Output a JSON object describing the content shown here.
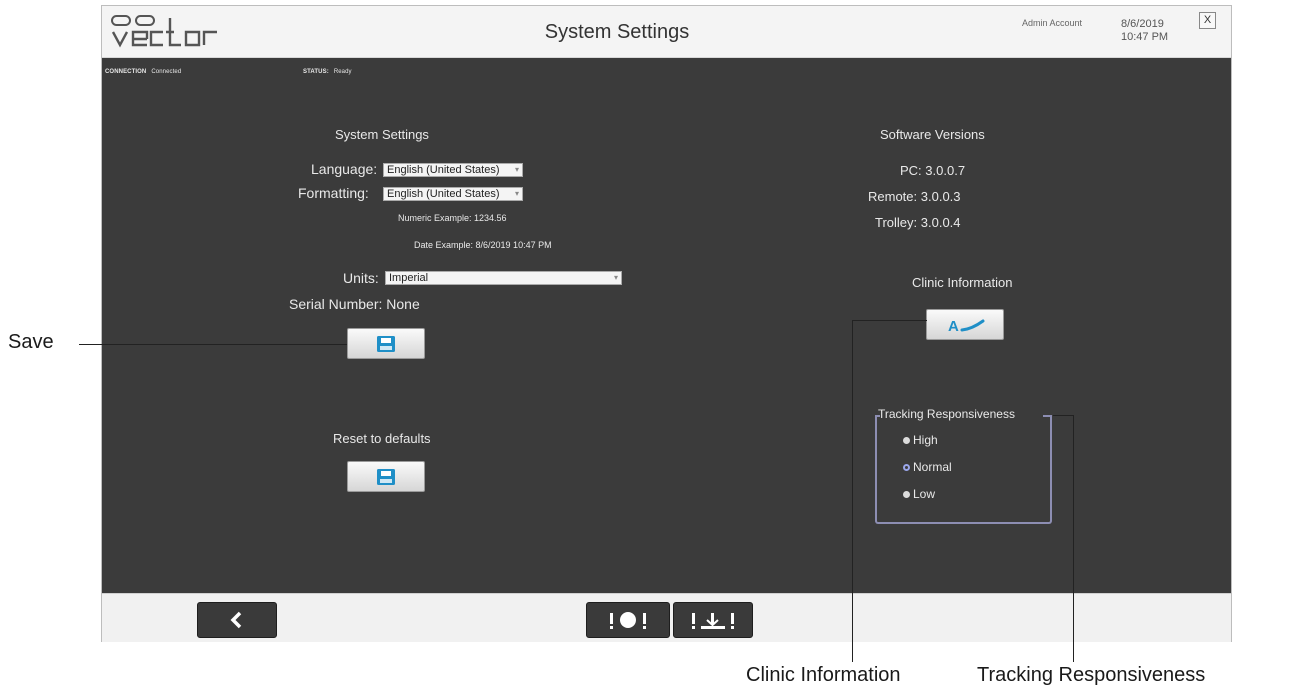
{
  "header": {
    "title": "System Settings",
    "account": "Admin Account",
    "date": "8/6/2019",
    "time": "10:47 PM",
    "close_label": "X"
  },
  "status_bar": {
    "connection_label": "CONNECTION",
    "connection_value": "Connected",
    "status_label": "STATUS:",
    "status_value": "Ready"
  },
  "system_settings": {
    "heading": "System Settings",
    "language_label": "Language:",
    "language_value": "English (United States)",
    "formatting_label": "Formatting:",
    "formatting_value": "English (United States)",
    "numeric_example": "Numeric Example:  1234.56",
    "date_example": "Date Example:  8/6/2019 10:47 PM",
    "units_label": "Units:",
    "units_value": "Imperial",
    "serial_label": "Serial Number:",
    "serial_value": "None",
    "reset_label": "Reset to defaults"
  },
  "software_versions": {
    "heading": "Software Versions",
    "pc_label": "PC:",
    "pc_value": "3.0.0.7",
    "remote_label": "Remote:",
    "remote_value": "3.0.0.3",
    "trolley_label": "Trolley:",
    "trolley_value": "3.0.0.4"
  },
  "clinic": {
    "heading": "Clinic Information"
  },
  "tracking": {
    "heading": "Tracking Responsiveness",
    "options": [
      "High",
      "Normal",
      "Low"
    ],
    "selected": "Normal"
  },
  "footer": {
    "back_icon": "chevron-left-icon",
    "stop_icon": "stop-all-icon",
    "floor_icon": "floor-lock-icon"
  },
  "callouts": {
    "save": "Save",
    "clinic": "Clinic Information",
    "tracking": "Tracking Responsiveness"
  },
  "colors": {
    "panel_background": "#3b3b3b",
    "accent_blue": "#1f8fc7",
    "radio_ring": "#9aa6ea",
    "group_border": "#8d8eb3"
  }
}
